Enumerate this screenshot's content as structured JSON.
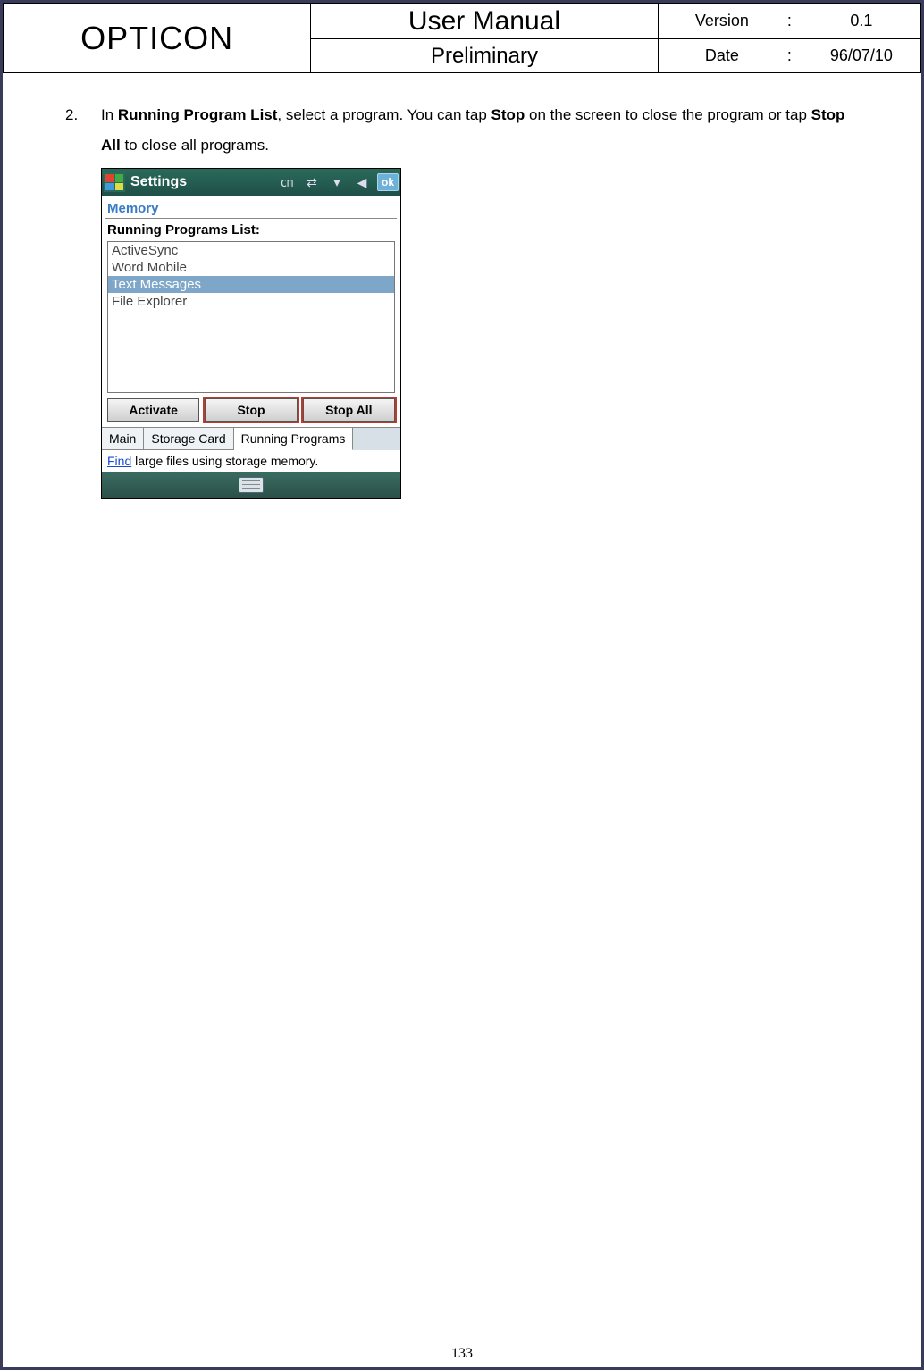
{
  "header": {
    "brand": "OPTICON",
    "title": "User Manual",
    "subtitle": "Preliminary",
    "version_label": "Version",
    "version_value": "0.1",
    "date_label": "Date",
    "date_value": "96/07/10",
    "colon": ":"
  },
  "step": {
    "num": "2.",
    "t1": "In ",
    "b1": "Running Program List",
    "t2": ", select a program. You can tap ",
    "b2": "Stop",
    "t3": " on the screen to close the program or tap ",
    "b3": "Stop All",
    "t4": " to close all programs."
  },
  "device": {
    "topbar_title": "Settings",
    "ok": "ok",
    "memory": "Memory",
    "list_title": "Running Programs List:",
    "apps": {
      "a0": "ActiveSync",
      "a1": "Word Mobile",
      "a2": "Text Messages",
      "a3": "File Explorer"
    },
    "buttons": {
      "activate": "Activate",
      "stop": "Stop",
      "stop_all": "Stop All"
    },
    "tabs": {
      "main": "Main",
      "storage": "Storage Card",
      "running": "Running Programs"
    },
    "find_link": "Find",
    "find_rest": " large files using storage memory."
  },
  "page_number": "133"
}
